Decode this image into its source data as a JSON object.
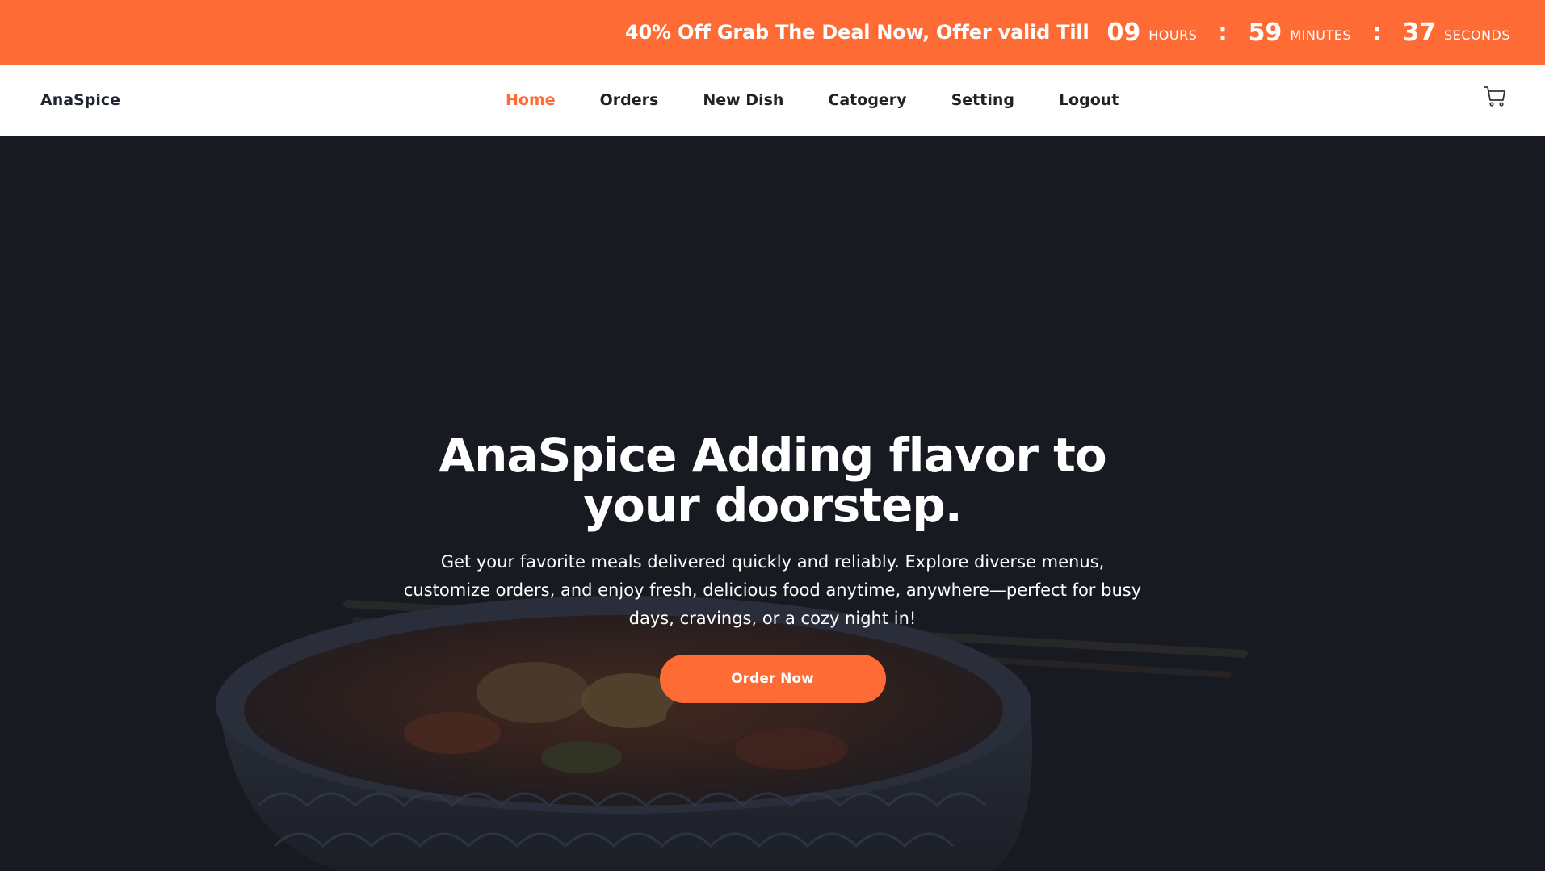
{
  "promo": {
    "text": "40% Off Grab The Deal Now, Offer valid Till",
    "countdown": {
      "hours": "09",
      "hours_label": "HOURS",
      "minutes": "59",
      "minutes_label": "MINUTES",
      "seconds": "37",
      "seconds_label": "SECONDS",
      "separator": ":"
    }
  },
  "navbar": {
    "brand": "AnaSpice",
    "links": [
      {
        "label": "Home"
      },
      {
        "label": "Orders"
      },
      {
        "label": "New Dish"
      },
      {
        "label": "Catogery"
      },
      {
        "label": "Setting"
      },
      {
        "label": "Logout"
      }
    ],
    "active": "Home",
    "cart_icon": "cart-icon"
  },
  "hero": {
    "title": "AnaSpice Adding flavor to your doorstep.",
    "description": "Get your favorite meals delivered quickly and reliably. Explore diverse menus, customize orders, and enjoy fresh, delicious food anytime, anywhere—perfect for busy days, cravings, or a cozy night in!",
    "cta_label": "Order Now",
    "background_image": "bowl-of-noodle-soup"
  },
  "colors": {
    "accent": "#ff6b35",
    "hero_bg": "#1b1e25",
    "nav_bg": "#ffffff"
  }
}
